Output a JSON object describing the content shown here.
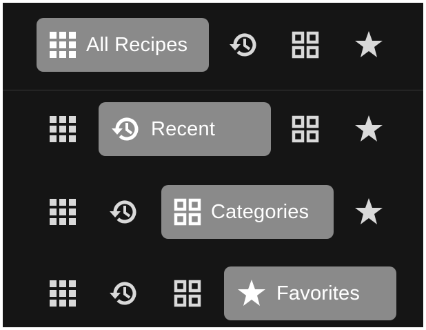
{
  "nav": {
    "tabs": [
      {
        "id": "all",
        "label": "All Recipes",
        "icon": "grid-icon"
      },
      {
        "id": "recent",
        "label": "Recent",
        "icon": "history-icon"
      },
      {
        "id": "categories",
        "label": "Categories",
        "icon": "categories-icon"
      },
      {
        "id": "favorites",
        "label": "Favorites",
        "icon": "star-icon"
      }
    ],
    "states": [
      {
        "selected": "All Recipes"
      },
      {
        "selected": "Recent"
      },
      {
        "selected": "Categories"
      },
      {
        "selected": "Favorites"
      }
    ]
  },
  "colors": {
    "background": "#151515",
    "selected_pill": "#8a8a8a",
    "icon_inactive": "#d9d9d9",
    "icon_active": "#ffffff",
    "label": "#ffffff",
    "divider": "#3a3a3a"
  }
}
